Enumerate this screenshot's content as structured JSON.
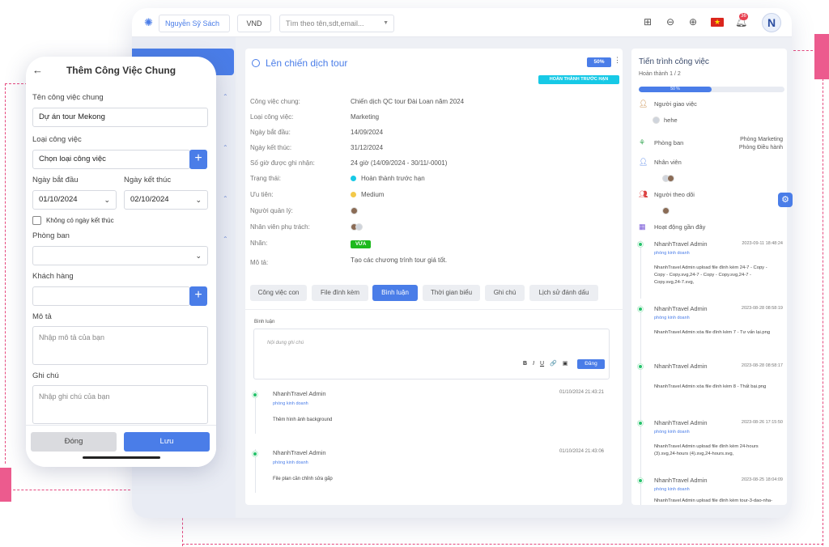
{
  "topbar": {
    "user": "Nguyễn Sỹ Sách",
    "currency": "VND",
    "search_placeholder": "Tìm theo tên,sdt,email...",
    "notification_count": "36",
    "avatar_letter": "N"
  },
  "task": {
    "title": "Lên chiến dịch tour",
    "progress_pct": "50%",
    "status_badge": "HOÀN THÀNH TRƯỚC HẠN",
    "fields": [
      {
        "label": "Công việc chung:",
        "value": "Chiến dịch QC tour Đài Loan năm 2024"
      },
      {
        "label": "Loại công việc:",
        "value": "Marketing"
      },
      {
        "label": "Ngày bắt đầu:",
        "value": "14/09/2024"
      },
      {
        "label": "Ngày kết thúc:",
        "value": "31/12/2024"
      },
      {
        "label": "Số giờ được ghi nhận:",
        "value": "24 giờ (14/09/2024 - 30/11/-0001)"
      },
      {
        "label": "Trạng thái:",
        "value": "Hoàn thành trước hạn"
      },
      {
        "label": "Ưu tiên:",
        "value": "Medium"
      },
      {
        "label": "Người quản lý:",
        "value": ""
      },
      {
        "label": "Nhân viên phụ trách:",
        "value": ""
      },
      {
        "label": "Nhãn:",
        "value": "VỪA"
      },
      {
        "label": "Mô tả:",
        "value": "Tạo các chương trình tour giá tốt."
      }
    ],
    "status_color": "#17c9e6",
    "priority_color": "#f3c94a",
    "tabs": [
      {
        "label": "Công việc con"
      },
      {
        "label": "File đính kèm"
      },
      {
        "label": "Bình luận"
      },
      {
        "label": "Thời gian biểu"
      },
      {
        "label": "Ghi chú"
      },
      {
        "label": "Lịch sử đánh dấu"
      }
    ],
    "active_tab": "Bình luận"
  },
  "comments": {
    "label": "Bình luận",
    "placeholder": "Nội dung ghi chú",
    "tools": [
      "B",
      "I",
      "U",
      "🔗",
      "▣"
    ],
    "send_label": "Đăng",
    "items": [
      {
        "name": "NhanhTravel Admin",
        "dept": "phòng kinh doanh",
        "time": "01/10/2024 21:43:21",
        "body": "Thêm hình ảnh background"
      },
      {
        "name": "NhanhTravel Admin",
        "dept": "phòng kinh doanh",
        "time": "01/10/2024 21:43:06",
        "body": "File plan cần chỉnh sửa gấp"
      }
    ]
  },
  "progress_panel": {
    "title": "Tiến trình công việc",
    "completed": "Hoàn thành 1 / 2",
    "bar_value": 0.5,
    "bar_label": "50 %",
    "assigner_label": "Người giao việc",
    "assigner_name": "hehe",
    "dept_label": "Phòng ban",
    "dept_values": [
      "Phòng Marketing",
      "Phòng Điều hành"
    ],
    "staff_label": "Nhân viên",
    "follower_label": "Người theo dõi",
    "activity_label": "Hoạt động gần đây",
    "activities": [
      {
        "name": "NhanhTravel Admin",
        "time": "2023-09-11 18:48:24",
        "dept": "phòng kinh doanh",
        "body": "NhanhTravel Admin upload file đính kèm 24-7 - Copy - Copy - Copy.svg,24-7 - Copy - Copy.svg,24-7 - Copy.svg,24-7.svg,"
      },
      {
        "name": "NhanhTravel Admin",
        "time": "2023-08-28 08:58:19",
        "dept": "phòng kinh doanh",
        "body": "NhanhTravel Admin xóa file đính kèm 7 - Tư vấn lại.png"
      },
      {
        "name": "NhanhTravel Admin",
        "time": "2023-08-28 08:58:17",
        "dept": "",
        "body": "NhanhTravel Admin xóa file đính kèm 8 - Thất bại.png"
      },
      {
        "name": "NhanhTravel Admin",
        "time": "2023-08-26 17:15:50",
        "dept": "phòng kinh doanh",
        "body": "NhanhTravel Admin upload file đính kèm 24-hours (3).svg,24-hours (4).svg,24-hours.svg,"
      },
      {
        "name": "NhanhTravel Admin",
        "time": "2023-08-25 18:04:09",
        "dept": "phòng kinh doanh",
        "body": "NhanhTravel Admin upload file đính kèm tour-3-dao-nha-trang-2.jpg,"
      }
    ]
  },
  "phone_form": {
    "title": "Thêm Công Việc Chung",
    "name_label": "Tên công việc chung",
    "name_value": "Dự án tour Mekong",
    "type_label": "Loại công việc",
    "type_value": "Chọn loại công việc",
    "start_label": "Ngày bắt đầu",
    "start_value": "01/10/2024",
    "end_label": "Ngày kết thúc",
    "end_value": "02/10/2024",
    "no_end_label": "Không có ngày kết thúc",
    "dept_label": "Phòng ban",
    "customer_label": "Khách hàng",
    "desc_label": "Mô tả",
    "desc_placeholder": "Nhập mô tả của bạn",
    "note_label": "Ghi chú",
    "note_placeholder": "Nhập ghi chú của bạn",
    "close_label": "Đóng",
    "save_label": "Lưu"
  }
}
